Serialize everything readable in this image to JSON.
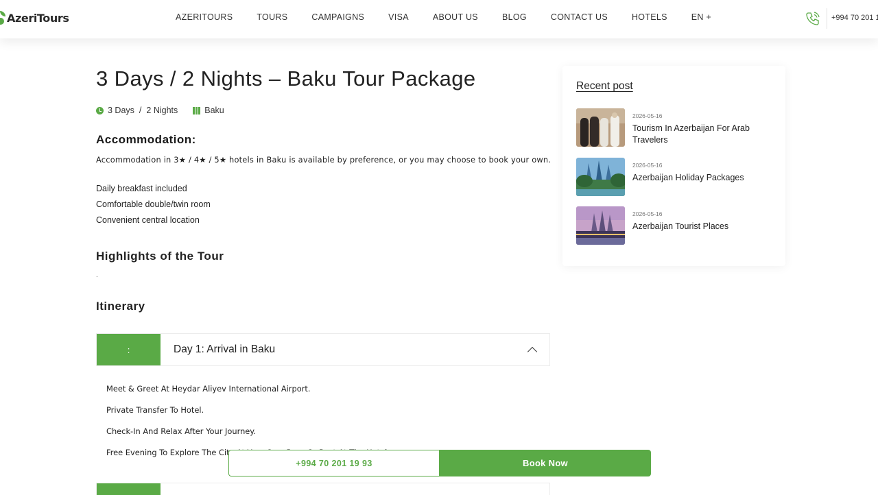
{
  "header": {
    "logo_text": "AzeriTours",
    "nav": [
      "AZERITOURS",
      "TOURS",
      "CAMPAIGNS",
      "VISA",
      "ABOUT US",
      "BLOG",
      "CONTACT US",
      "HOTELS",
      "EN +"
    ],
    "phone": "+994 70 201 1"
  },
  "main": {
    "title": "3 Days / 2 Nights – Baku Tour Package",
    "meta": {
      "days": "3 Days",
      "separator": "/",
      "nights": "2 Nights",
      "location": "Baku"
    },
    "accommodation_heading": "Accommodation:",
    "accommodation_text": "Accommodation in 3★ / 4★ / 5★ hotels in Baku is available by preference, or you may choose to book your own.",
    "features": [
      "Daily breakfast included",
      "Comfortable double/twin room",
      "Convenient central location"
    ],
    "highlights_heading": "Highlights of the Tour",
    "highlights_text": ".",
    "itinerary_heading": "Itinerary",
    "days": [
      {
        "number": ":",
        "title": "Day 1: Arrival in Baku",
        "items": [
          "Meet & Greet At Heydar Aliyev International Airport.",
          "Private Transfer To Hotel.",
          "Check-In And Relax After Your Journey.",
          "Free Evening To Explore The City At Your Own Pace Or Rest At The Hotel."
        ]
      }
    ]
  },
  "sidebar": {
    "title": "Recent post",
    "posts": [
      {
        "date": "2026-05-16",
        "title": "Tourism In Azerbaijan For Arab Travelers"
      },
      {
        "date": "2026-05-16",
        "title": "Azerbaijan Holiday Packages"
      },
      {
        "date": "2026-05-16",
        "title": "Azerbaijan Tourist Places"
      }
    ]
  },
  "cta": {
    "phone": "+994 70 201 19 93",
    "book": "Book Now"
  },
  "colors": {
    "accent": "#5aaa46",
    "text": "#222222"
  }
}
